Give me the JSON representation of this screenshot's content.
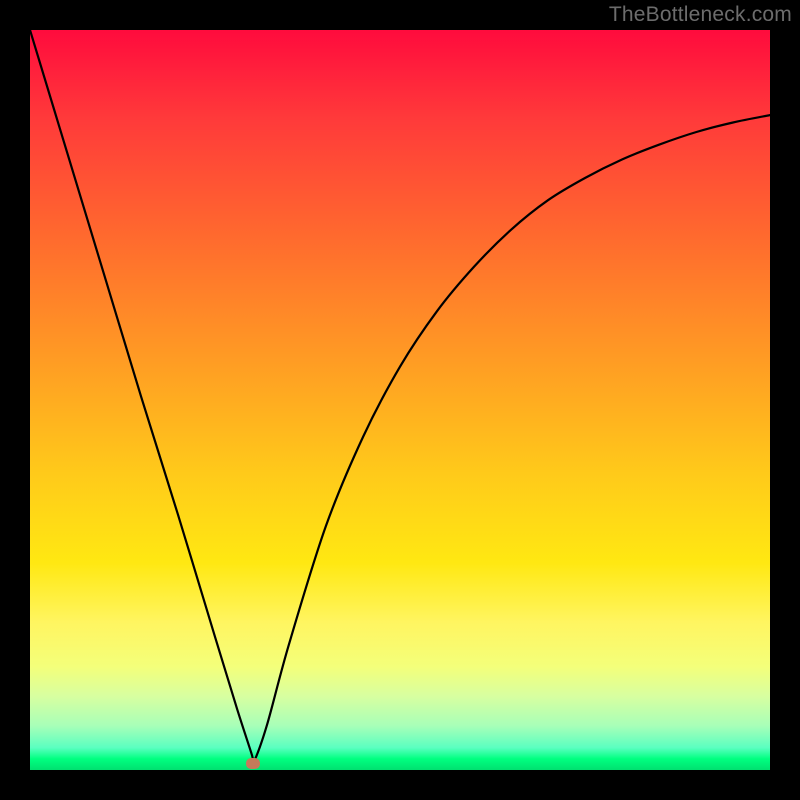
{
  "watermark": "TheBottleneck.com",
  "marker": {
    "x_frac": 0.302,
    "y_frac": 0.992
  },
  "chart_data": {
    "type": "line",
    "title": "",
    "xlabel": "",
    "ylabel": "",
    "axes_visible": false,
    "background_gradient": {
      "orientation": "vertical",
      "stops": [
        {
          "pos": 0.0,
          "color": "#ff0b3d"
        },
        {
          "pos": 0.28,
          "color": "#ff6a2e"
        },
        {
          "pos": 0.6,
          "color": "#ffca1a"
        },
        {
          "pos": 0.8,
          "color": "#fff560"
        },
        {
          "pos": 0.94,
          "color": "#a8ffb8"
        },
        {
          "pos": 1.0,
          "color": "#00e070"
        }
      ]
    },
    "notes": "Axes, ticks, and units are not shown; x and y are normalized fractions of the plot area (0–1, origin bottom-left). Curve is a sharp V/valley near x≈0.30 with a steep near-linear left arm and a concave-decelerating right arm.",
    "series": [
      {
        "name": "bottleneck-curve",
        "color": "#000000",
        "x": [
          0.0,
          0.05,
          0.1,
          0.15,
          0.2,
          0.25,
          0.28,
          0.3,
          0.302,
          0.32,
          0.35,
          0.4,
          0.45,
          0.5,
          0.55,
          0.6,
          0.65,
          0.7,
          0.75,
          0.8,
          0.85,
          0.9,
          0.95,
          1.0
        ],
        "y": [
          1.0,
          0.835,
          0.67,
          0.505,
          0.345,
          0.18,
          0.082,
          0.02,
          0.01,
          0.06,
          0.17,
          0.33,
          0.45,
          0.545,
          0.62,
          0.68,
          0.73,
          0.77,
          0.8,
          0.825,
          0.845,
          0.862,
          0.875,
          0.885
        ]
      }
    ],
    "marker_point": {
      "x": 0.302,
      "y": 0.01,
      "color": "#c47a5a",
      "shape": "rounded-rect"
    }
  }
}
